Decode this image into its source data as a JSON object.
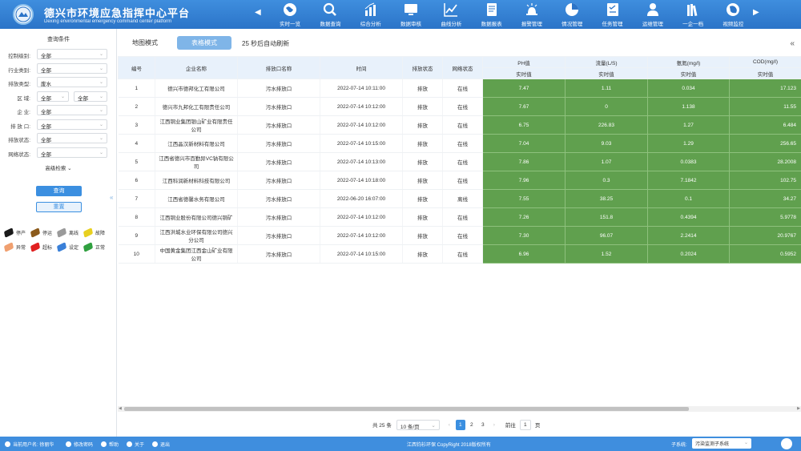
{
  "header": {
    "title": "德兴市环境应急指挥中心平台",
    "subtitle": "Dexing environmental emergency command center platform",
    "nav": [
      {
        "label": "实时一览",
        "icon": "globe-icon"
      },
      {
        "label": "数据查询",
        "icon": "search-icon"
      },
      {
        "label": "综合分析",
        "icon": "bar-chart-icon"
      },
      {
        "label": "数据审核",
        "icon": "monitor-icon"
      },
      {
        "label": "曲线分析",
        "icon": "line-chart-icon"
      },
      {
        "label": "数据报表",
        "icon": "report-icon"
      },
      {
        "label": "报警管理",
        "icon": "alarm-icon"
      },
      {
        "label": "情况管理",
        "icon": "pie-icon"
      },
      {
        "label": "任务管理",
        "icon": "task-icon"
      },
      {
        "label": "运维管理",
        "icon": "user-icon"
      },
      {
        "label": "一企一档",
        "icon": "books-icon"
      },
      {
        "label": "视频监控",
        "icon": "video-globe-icon"
      }
    ]
  },
  "sidebar": {
    "title": "查询条件",
    "filters": [
      {
        "label": "控制级别:",
        "value": "全部"
      },
      {
        "label": "行业类别:",
        "value": "全部"
      },
      {
        "label": "排放类型:",
        "value": "废水"
      },
      {
        "label": "区 域:",
        "value": "全部",
        "value2": "全部"
      },
      {
        "label": "企 业:",
        "value": "全部"
      },
      {
        "label": "排 放 口:",
        "value": "全部"
      },
      {
        "label": "排放状态:",
        "value": "全部"
      },
      {
        "label": "网络状态:",
        "value": "全部"
      }
    ],
    "advanced": "高级检索",
    "query": "查询",
    "reset": "重置",
    "legend": [
      {
        "label": "停产",
        "color": "#1a1a1a"
      },
      {
        "label": "停运",
        "color": "#8b5a1b"
      },
      {
        "label": "离线",
        "color": "#9a9a9a"
      },
      {
        "label": "故障",
        "color": "#e8d020"
      },
      {
        "label": "异常",
        "color": "#f0a070"
      },
      {
        "label": "超标",
        "color": "#e02020"
      },
      {
        "label": "设定",
        "color": "#3a80d8"
      },
      {
        "label": "正常",
        "color": "#30a040"
      }
    ]
  },
  "main": {
    "tabs": [
      "地图模式",
      "表格模式"
    ],
    "refresh": "25 秒后自动刷新",
    "columns": [
      "编号",
      "企业名称",
      "排放口名称",
      "时间",
      "排放状态",
      "网络状态",
      "PH值",
      "流量(L/S)",
      "氨氮(mg/l)",
      "COD(mg/l)"
    ],
    "subheader": "实时值",
    "rows": [
      [
        "1",
        "德兴市德邦化工有限公司",
        "污水排放口",
        "2022-07-14 10:11:00",
        "排放",
        "在线",
        "7.47",
        "1.11",
        "0.034",
        "17.123"
      ],
      [
        "2",
        "德兴市九邦化工有限责任公司",
        "污水排放口",
        "2022-07-14 10:12:00",
        "排放",
        "在线",
        "7.67",
        "0",
        "1.138",
        "11.55"
      ],
      [
        "3",
        "江西铜业集团银山矿业有限责任公司",
        "污水排放口",
        "2022-07-14 10:12:00",
        "排放",
        "在线",
        "6.75",
        "226.83",
        "1.27",
        "6.484"
      ],
      [
        "4",
        "江西晶汉新材料有限公司",
        "污水排放口",
        "2022-07-14 10:15:00",
        "排放",
        "在线",
        "7.04",
        "9.03",
        "1.29",
        "256.65"
      ],
      [
        "5",
        "江西省德兴市百勤异VC钠有限公司",
        "污水排放口",
        "2022-07-14 10:13:00",
        "排放",
        "在线",
        "7.86",
        "1.07",
        "0.0383",
        "28.2008"
      ],
      [
        "6",
        "江西科润新材料科技有限公司",
        "污水排放口",
        "2022-07-14 10:18:00",
        "排放",
        "在线",
        "7.96",
        "0.3",
        "7.1842",
        "102.75"
      ],
      [
        "7",
        "江西省德馨水务有限公司",
        "污水排放口",
        "2022-06-20 16:07:00",
        "排放",
        "离线",
        "7.55",
        "38.25",
        "0.1",
        "34.27"
      ],
      [
        "8",
        "江西铜业股份有限公司德兴铜矿",
        "污水排放口",
        "2022-07-14 10:12:00",
        "排放",
        "在线",
        "7.26",
        "151.8",
        "0.4394",
        "5.9778"
      ],
      [
        "9",
        "江西洪城水业环保有限公司德兴分公司",
        "污水排放口",
        "2022-07-14 10:12:00",
        "排放",
        "在线",
        "7.30",
        "96.07",
        "2.2414",
        "20.9767"
      ],
      [
        "10",
        "中国黄金集团江西金山矿业有限公司",
        "污水排放口",
        "2022-07-14 10:15:00",
        "排放",
        "在线",
        "6.96",
        "1.52",
        "0.2024",
        "0.5952"
      ]
    ]
  },
  "pager": {
    "total": "共 25 条",
    "size": "10 条/页",
    "pages": [
      "1",
      "2",
      "3"
    ],
    "goto": "前往",
    "goto_val": "1",
    "page_unit": "页"
  },
  "footer": {
    "user": "当前用户名: 徐丽华",
    "pwd": "修改密码",
    "help": "帮助",
    "about": "关于",
    "exit": "退出",
    "copyright": "江西钧衫环保  CopyRight  2018版权所有",
    "sys_label": "子系统:",
    "sys_value": "污染监测子系统"
  }
}
